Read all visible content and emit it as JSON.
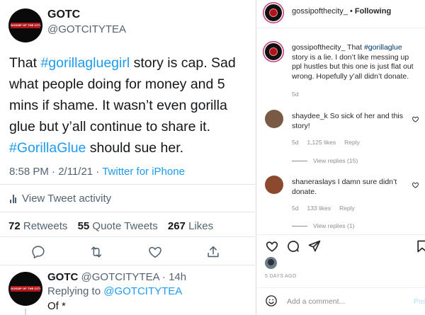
{
  "twitter": {
    "tweet": {
      "avatar_text": "GOSSIP OF THE CITY",
      "name": "GOTC",
      "handle": "@GOTCITYTEA",
      "body_line1_pre": "That ",
      "body_hashtag1": "#gorillagluegirl",
      "body_line1_post": " story is cap. Sad what people doing for money and 5 mins if shame. It wasn’t even gorilla glue but y’all continue to share it. ",
      "body_hashtag2": "#GorillaGlue",
      "body_end": " should sue her.",
      "timestamp": "8:58 PM · 2/11/21 · ",
      "source": "Twitter for iPhone",
      "activity_label": "View Tweet activity",
      "retweets_count": "72",
      "retweets_label": "Retweets",
      "quotes_count": "55",
      "quotes_label": "Quote Tweets",
      "likes_count": "267",
      "likes_label": "Likes"
    },
    "reply": {
      "avatar_text": "GOSSIP OF THE CITY",
      "name": "GOTC",
      "handle_time": "@GOTCITYTEA · 14h",
      "replying_prefix": "Replying to ",
      "replying_handle": "@GOTCITYTEA",
      "text": "Of *"
    }
  },
  "instagram": {
    "header": {
      "username": "gossipofthecity_",
      "separator": " • ",
      "follow_state": "Following"
    },
    "caption": {
      "username": "gossipofthecity_",
      "pre": " That ",
      "hashtag": "#gorillaglue",
      "post": " story is a lie. I don’t like messing up ppl hustles but this one is just flat out wrong. Hopefully y’all didn’t donate.",
      "age": "5d"
    },
    "comments": [
      {
        "username": "shaydee_k",
        "text": " So sick of her and this story!",
        "age": "5d",
        "likes": "1,125 likes",
        "reply": "Reply",
        "view_replies": "View replies (15)"
      },
      {
        "username": "shaneraslays",
        "text": " I damn sure didn’t donate.",
        "age": "5d",
        "likes": "133 likes",
        "reply": "Reply",
        "view_replies": "View replies (1)"
      }
    ],
    "posted": "5 DAYS AGO",
    "add_comment_placeholder": "Add a comment...",
    "post_label": "Post"
  },
  "colors": {
    "twitter_blue": "#1d9bf0",
    "ig_link": "#00376b",
    "ig_post_disabled": "#b2dffc",
    "brand_red": "#b0161a"
  }
}
